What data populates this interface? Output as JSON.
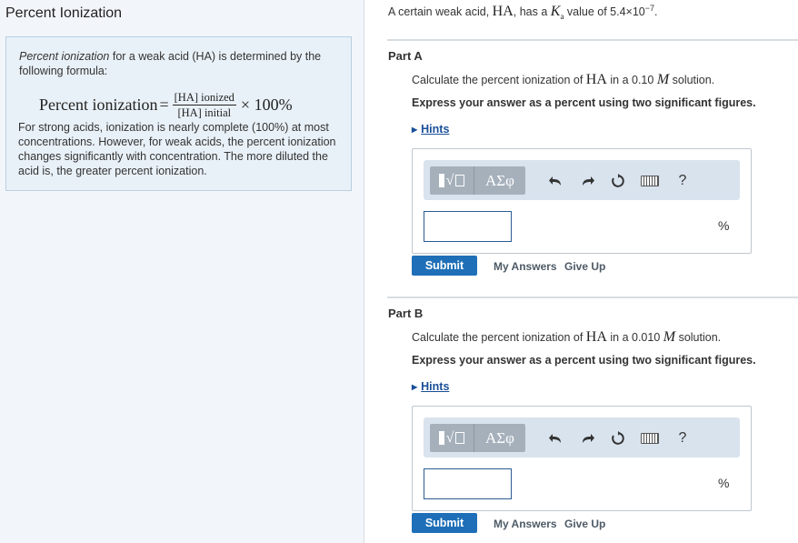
{
  "left": {
    "title": "Percent Ionization",
    "intro_em": "Percent ionization",
    "intro_rest": " for a weak acid (HA) is determined by the following formula:",
    "formula": {
      "lhs": "Percent ionization",
      "eq": "=",
      "numerator": "[HA] ionized",
      "denominator": "[HA] initial",
      "times": "× 100%"
    },
    "body": "For strong acids, ionization is nearly complete (100%) at most concentrations. However, for weak acids, the percent ionization changes significantly with concentration. The more diluted the acid is, the greater percent ionization."
  },
  "problem": {
    "pre": "A certain weak acid, ",
    "acid": "HA",
    "mid": ", has a ",
    "k": "K",
    "k_sub": "a",
    "post": " value of 5.4×10",
    "exp": "−7",
    "end": "."
  },
  "parts": [
    {
      "title": "Part A",
      "q_pre": "Calculate the percent ionization of ",
      "q_acid": "HA",
      "q_mid": " in a 0.10 ",
      "q_unit": "M",
      "q_post": " solution.",
      "instruction": "Express your answer as a percent using two significant figures.",
      "hints": "Hints",
      "greek_label": "ΑΣφ",
      "help_label": "?",
      "unit": "%",
      "answer_value": "",
      "submit": "Submit",
      "my_answers": "My Answers",
      "give_up": "Give Up"
    },
    {
      "title": "Part B",
      "q_pre": "Calculate the percent ionization of ",
      "q_acid": "HA",
      "q_mid": " in a 0.010 ",
      "q_unit": "M",
      "q_post": " solution.",
      "instruction": "Express your answer as a percent using two significant figures.",
      "hints": "Hints",
      "greek_label": "ΑΣφ",
      "help_label": "?",
      "unit": "%",
      "answer_value": "",
      "submit": "Submit",
      "my_answers": "My Answers",
      "give_up": "Give Up"
    }
  ],
  "icons": {
    "template": "template-icon",
    "undo": "undo-icon",
    "redo": "redo-icon",
    "reset": "reset-icon",
    "keyboard": "keyboard-icon",
    "help": "help-icon"
  },
  "colors": {
    "accent": "#1f6fb8",
    "link": "#1a4f98",
    "panel_bg": "#e9f1f8",
    "toolbar_bg": "#d9e3ee"
  }
}
